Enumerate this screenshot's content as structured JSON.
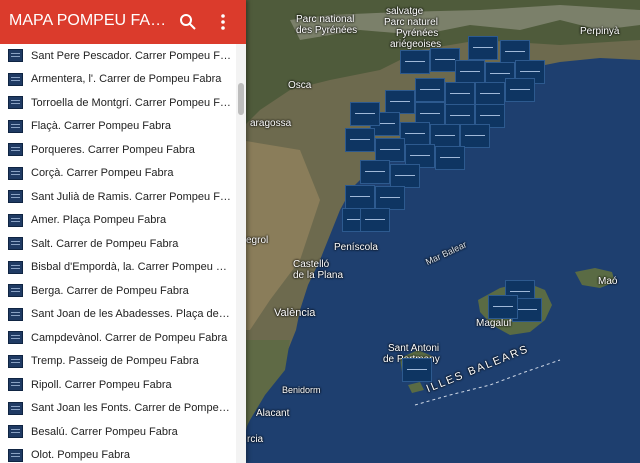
{
  "header": {
    "title": "MAPA POMPEU FABRA..."
  },
  "icons": {
    "search": "search-icon",
    "more": "more-vert-icon",
    "layer": "layer-icon"
  },
  "colors": {
    "header": "#db3b2c",
    "marker": "#0e3562",
    "sea": "#1d3d6e"
  },
  "list": {
    "items": [
      "Sant Pere Pescador. Carrer Pompeu Fabra",
      "Armentera, l'. Carrer de Pompeu Fabra",
      "Torroella de Montgrí. Carrer Pompeu Fabra",
      "Flaçà. Carrer Pompeu Fabra",
      "Porqueres. Carrer Pompeu Fabra",
      "Corçà. Carrer Pompeu Fabra",
      "Sant Julià de Ramis. Carrer Pompeu Fab...",
      "Amer. Plaça Pompeu Fabra",
      "Salt. Carrer de Pompeu Fabra",
      "Bisbal d'Empordà, la. Carrer Pompeu Fa...",
      "Berga. Carrer de Pompeu Fabra",
      "Sant Joan de les Abadesses. Plaça de P...",
      "Campdevànol. Carrer de Pompeu Fabra",
      "Tremp. Passeig de Pompeu Fabra",
      "Ripoll. Carrer Pompeu Fabra",
      "Sant Joan les Fonts.  Carrer de Pompeu ...",
      "Besalú. Carrer Pompeu Fabra",
      "Olot. Pompeu Fabra"
    ]
  },
  "map_labels": {
    "parc_nacional": "Parc national",
    "pyrenees": "des Pyrénées",
    "salvatge": "salvatge",
    "parc_naturel": "Parc naturel",
    "ariegeoises": "Pyrénées",
    "ariegeoises2": "ariégeoises",
    "perpinya": "Perpinyà",
    "osca": "Osca",
    "saragossa": "aragossa",
    "egrol": "egrol",
    "peniscola": "Peníscola",
    "castello": "Castelló",
    "castello2": "de la Plana",
    "valencia": "València",
    "sant_antoni": "Sant Antoni",
    "sant_antoni2": "de Portmany",
    "magaluf": "Magaluf",
    "illes_balears": "ILLES BALEARS",
    "mar_balear": "Mar Balear",
    "mao": "Maó",
    "benidorm": "Benidorm",
    "alacant": "Alacant",
    "rcia": "rcia"
  }
}
